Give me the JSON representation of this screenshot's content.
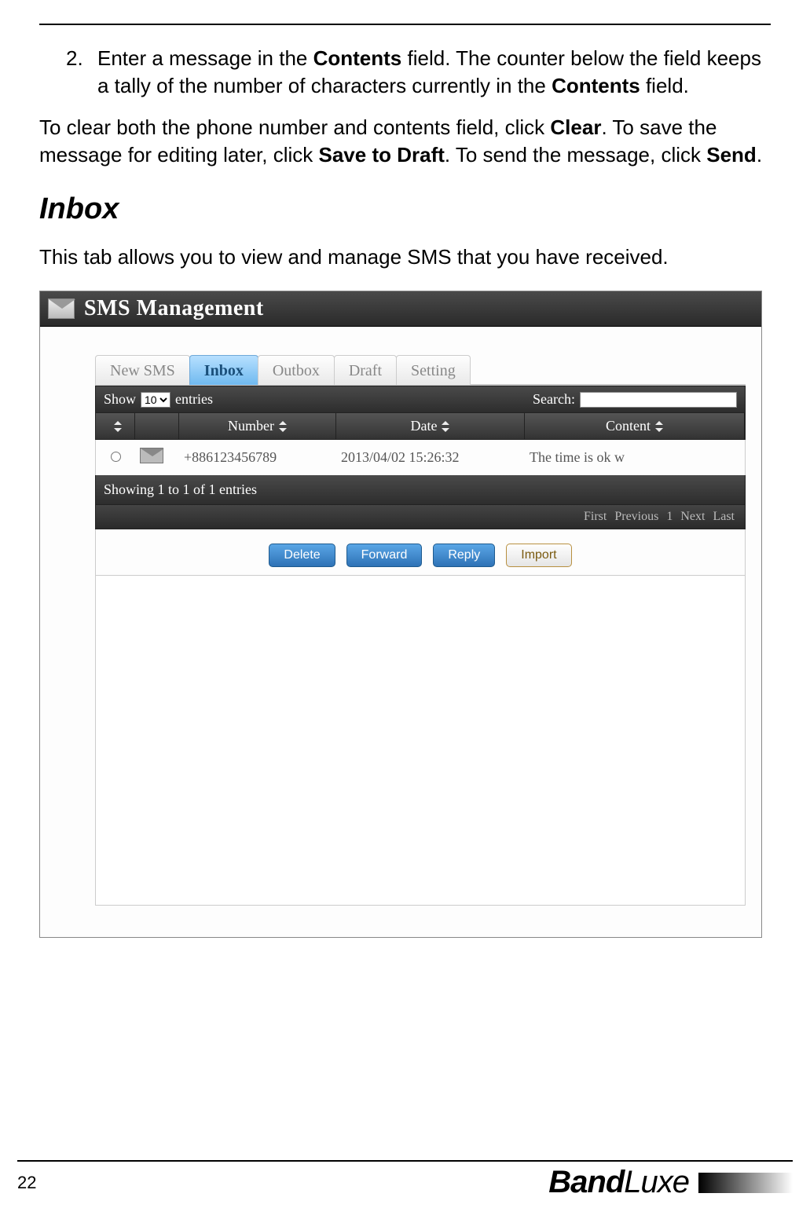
{
  "doc": {
    "step2_num": "2.",
    "step2_a": "Enter a message in the ",
    "step2_b": "Contents",
    "step2_c": " field. The counter below the field keeps a tally of the number of characters currently in the ",
    "step2_d": "Contents",
    "step2_e": " field.",
    "para_a": "To clear both the phone number and contents field, click ",
    "para_b": "Clear",
    "para_c": ". To save the message for editing later, click ",
    "para_d": "Save to Draft",
    "para_e": ". To send the message, click ",
    "para_f": "Send",
    "para_g": ".",
    "h2": "Inbox",
    "intro": "This tab allows you to view and manage SMS that you have received."
  },
  "app": {
    "title": "SMS Management",
    "tabs": {
      "new": "New SMS",
      "inbox": "Inbox",
      "outbox": "Outbox",
      "draft": "Draft",
      "setting": "Setting"
    },
    "toolbar": {
      "show_a": "Show",
      "show_val": "10",
      "show_b": "entries",
      "search_label": "Search:"
    },
    "columns": {
      "number": "Number",
      "date": "Date",
      "content": "Content"
    },
    "rows": [
      {
        "number": "+886123456789",
        "date": "2013/04/02 15:26:32",
        "content": "The time is ok w"
      }
    ],
    "status": "Showing 1 to 1 of 1 entries",
    "pager": {
      "first": "First",
      "prev": "Previous",
      "page": "1",
      "next": "Next",
      "last": "Last"
    },
    "buttons": {
      "delete": "Delete",
      "forward": "Forward",
      "reply": "Reply",
      "import": "Import"
    }
  },
  "footer": {
    "page": "22",
    "brand_a": "Band",
    "brand_b": "Luxe"
  }
}
